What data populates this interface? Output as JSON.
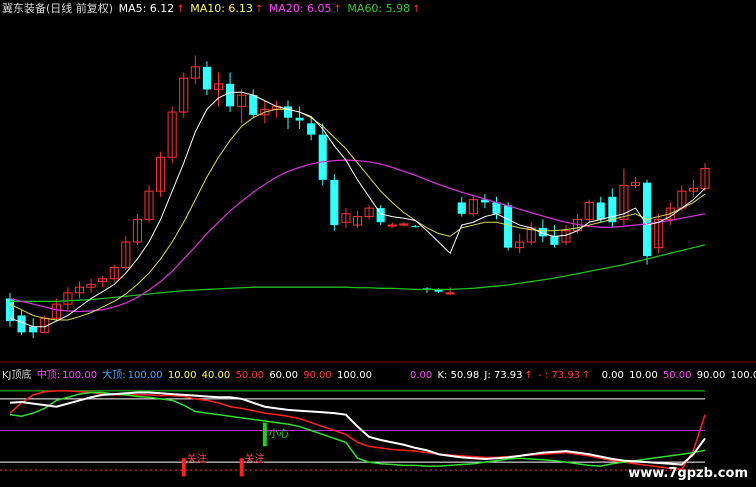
{
  "header": {
    "title": "冀东装备(日线 前复权)",
    "ma5_label": "MA5: 6.12",
    "ma10_label": "MA10: 6.13",
    "ma20_label": "MA20: 6.05",
    "ma60_label": "MA60: 5.98",
    "arrow": "↑",
    "colors": {
      "title": "#d8d8d8",
      "ma5": "#ffffff",
      "ma10": "#ffff66",
      "ma20": "#ff44ff",
      "ma60": "#33cc33",
      "arrow": "#ff3333"
    }
  },
  "indicator_header": {
    "name": "KJ顶底",
    "mid_label": "中顶:",
    "mid_value": "100.00",
    "big_label": "大顶:",
    "big_value": "100.00",
    "v1": "10.00",
    "v2": "40.00",
    "v3": "50.00",
    "v4": "60.00",
    "v5": "90.00",
    "v6": "100.00",
    "r0": "0.00",
    "k_label": "K: 50.98",
    "j_label": "J: 73.93",
    "dash_label": "- : 73.93",
    "r1": "0.00",
    "r2": "10.00",
    "r3": "50.00",
    "r4": "90.00",
    "r5": "100.00",
    "arrow": "↑"
  },
  "annotations": {
    "buy1": "关注",
    "buy2": "关注",
    "heart": "小心"
  },
  "watermark": "www.7gpzb.com",
  "chart_data": [
    {
      "type": "candlestick",
      "title": "冀东装备(日线 前复权)",
      "ohlc": [
        [
          5.6,
          5.7,
          5.1,
          5.2
        ],
        [
          5.3,
          5.4,
          4.95,
          5.0
        ],
        [
          5.1,
          5.25,
          4.9,
          5.0
        ],
        [
          5.0,
          5.3,
          4.98,
          5.25
        ],
        [
          5.25,
          5.6,
          5.2,
          5.5
        ],
        [
          5.5,
          5.8,
          5.4,
          5.7
        ],
        [
          5.7,
          5.9,
          5.6,
          5.8
        ],
        [
          5.8,
          5.95,
          5.7,
          5.85
        ],
        [
          5.9,
          6.0,
          5.8,
          5.95
        ],
        [
          5.95,
          6.2,
          5.9,
          6.15
        ],
        [
          6.15,
          6.7,
          6.1,
          6.6
        ],
        [
          6.6,
          7.1,
          6.55,
          7.0
        ],
        [
          7.0,
          7.6,
          6.95,
          7.5
        ],
        [
          7.5,
          8.2,
          7.4,
          8.1
        ],
        [
          8.1,
          9.0,
          8.0,
          8.9
        ],
        [
          8.9,
          9.6,
          8.8,
          9.5
        ],
        [
          9.5,
          9.9,
          9.4,
          9.7
        ],
        [
          9.7,
          9.8,
          9.2,
          9.3
        ],
        [
          9.3,
          9.6,
          9.0,
          9.4
        ],
        [
          9.4,
          9.6,
          8.9,
          9.0
        ],
        [
          9.0,
          9.3,
          8.7,
          9.2
        ],
        [
          9.2,
          9.3,
          8.8,
          8.85
        ],
        [
          8.85,
          9.1,
          8.7,
          8.95
        ],
        [
          8.95,
          9.1,
          8.8,
          9.0
        ],
        [
          9.0,
          9.1,
          8.6,
          8.8
        ],
        [
          8.8,
          9.0,
          8.6,
          8.75
        ],
        [
          8.7,
          8.8,
          8.4,
          8.5
        ],
        [
          8.5,
          8.7,
          7.6,
          7.7
        ],
        [
          7.7,
          7.8,
          6.8,
          6.9
        ],
        [
          6.95,
          7.2,
          6.85,
          7.1
        ],
        [
          6.9,
          7.15,
          6.85,
          7.05
        ],
        [
          7.05,
          7.25,
          7.0,
          7.2
        ],
        [
          7.2,
          7.25,
          6.9,
          6.95
        ],
        [
          6.9,
          6.95,
          6.85,
          6.9
        ],
        [
          6.9,
          6.95,
          6.88,
          6.92
        ],
        [
          6.88,
          6.9,
          6.86,
          6.87
        ],
        [
          5.78,
          5.8,
          5.7,
          5.76
        ],
        [
          5.75,
          5.78,
          5.7,
          5.72
        ],
        [
          5.7,
          5.8,
          5.66,
          5.7
        ],
        [
          7.3,
          7.4,
          7.05,
          7.1
        ],
        [
          7.1,
          7.4,
          7.05,
          7.35
        ],
        [
          7.35,
          7.45,
          7.2,
          7.3
        ],
        [
          7.3,
          7.4,
          7.0,
          7.1
        ],
        [
          7.25,
          7.3,
          6.45,
          6.5
        ],
        [
          6.5,
          6.75,
          6.4,
          6.6
        ],
        [
          6.6,
          6.95,
          6.55,
          6.85
        ],
        [
          6.85,
          7.0,
          6.6,
          6.7
        ],
        [
          6.7,
          6.9,
          6.5,
          6.55
        ],
        [
          6.6,
          6.9,
          6.55,
          6.8
        ],
        [
          6.8,
          7.1,
          6.75,
          7.0
        ],
        [
          7.0,
          7.35,
          6.95,
          7.3
        ],
        [
          7.3,
          7.4,
          6.95,
          7.0
        ],
        [
          7.4,
          7.55,
          6.85,
          6.95
        ],
        [
          7.0,
          7.9,
          6.9,
          7.6
        ],
        [
          7.6,
          7.75,
          7.55,
          7.65
        ],
        [
          7.65,
          7.7,
          6.2,
          6.35
        ],
        [
          6.5,
          7.1,
          6.4,
          7.0
        ],
        [
          7.0,
          7.3,
          6.9,
          7.2
        ],
        [
          7.2,
          7.6,
          7.15,
          7.5
        ],
        [
          7.5,
          7.7,
          7.4,
          7.55
        ],
        [
          7.55,
          8.0,
          7.5,
          7.9
        ]
      ],
      "ma5": [
        5.25,
        5.18,
        5.1,
        5.1,
        5.2,
        5.3,
        5.45,
        5.6,
        5.72,
        5.85,
        6.05,
        6.3,
        6.6,
        7.0,
        7.5,
        8.0,
        8.55,
        8.95,
        9.15,
        9.25,
        9.25,
        9.2,
        9.1,
        9.0,
        8.95,
        8.9,
        8.82,
        8.6,
        8.3,
        8.05,
        7.7,
        7.4,
        7.1,
        7.05,
        7.02,
        6.98,
        6.8,
        6.6,
        6.4,
        6.9,
        6.95,
        7.05,
        7.1,
        7.0,
        6.9,
        6.85,
        6.75,
        6.7,
        6.72,
        6.8,
        6.95,
        7.0,
        7.05,
        7.1,
        7.2,
        6.9,
        6.95,
        7.05,
        7.2,
        7.35,
        7.55
      ],
      "ma10": [
        5.5,
        5.4,
        5.3,
        5.25,
        5.22,
        5.22,
        5.28,
        5.35,
        5.45,
        5.55,
        5.68,
        5.85,
        6.05,
        6.3,
        6.6,
        6.95,
        7.35,
        7.75,
        8.1,
        8.4,
        8.65,
        8.8,
        8.9,
        8.95,
        8.95,
        8.9,
        8.8,
        8.65,
        8.45,
        8.25,
        8.0,
        7.75,
        7.5,
        7.3,
        7.12,
        6.98,
        6.85,
        6.75,
        6.7,
        6.85,
        6.9,
        6.95,
        6.95,
        6.9,
        6.85,
        6.82,
        6.8,
        6.8,
        6.82,
        6.85,
        6.9,
        6.95,
        7.0,
        7.05,
        7.1,
        7.0,
        7.05,
        7.1,
        7.2,
        7.3,
        7.45
      ],
      "ma20": [
        5.6,
        5.55,
        5.5,
        5.45,
        5.4,
        5.38,
        5.37,
        5.38,
        5.4,
        5.45,
        5.52,
        5.62,
        5.75,
        5.9,
        6.08,
        6.3,
        6.52,
        6.75,
        6.95,
        7.15,
        7.32,
        7.48,
        7.62,
        7.75,
        7.85,
        7.92,
        7.98,
        8.02,
        8.04,
        8.05,
        8.04,
        8.02,
        7.98,
        7.92,
        7.85,
        7.78,
        7.7,
        7.62,
        7.55,
        7.48,
        7.42,
        7.36,
        7.3,
        7.24,
        7.18,
        7.12,
        7.06,
        7.0,
        6.95,
        6.91,
        6.88,
        6.86,
        6.86,
        6.88,
        6.9,
        6.92,
        6.95,
        6.98,
        7.02,
        7.06,
        7.1
      ],
      "ma60": [
        5.55,
        5.55,
        5.55,
        5.55,
        5.55,
        5.56,
        5.57,
        5.58,
        5.6,
        5.62,
        5.64,
        5.66,
        5.68,
        5.7,
        5.72,
        5.74,
        5.75,
        5.76,
        5.77,
        5.78,
        5.79,
        5.8,
        5.8,
        5.8,
        5.8,
        5.8,
        5.8,
        5.8,
        5.8,
        5.8,
        5.79,
        5.79,
        5.78,
        5.78,
        5.77,
        5.76,
        5.76,
        5.76,
        5.76,
        5.77,
        5.78,
        5.8,
        5.82,
        5.84,
        5.87,
        5.9,
        5.93,
        5.96,
        6.0,
        6.04,
        6.08,
        6.12,
        6.16,
        6.2,
        6.25,
        6.3,
        6.35,
        6.4,
        6.45,
        6.5,
        6.55
      ],
      "ylim": [
        4.6,
        10.6
      ],
      "grid": false
    },
    {
      "type": "line",
      "title": "KJ顶底",
      "ylim": [
        -10,
        110
      ],
      "hlines": [
        100,
        90,
        50,
        10,
        0
      ],
      "white": [
        85,
        86,
        84,
        82,
        80,
        84,
        88,
        92,
        95,
        96,
        97,
        98,
        98,
        97,
        96,
        95,
        94,
        93,
        92,
        92,
        90,
        85,
        80,
        78,
        76,
        75,
        74,
        73,
        72,
        70,
        55,
        42,
        38,
        35,
        32,
        28,
        25,
        20,
        18,
        16,
        15,
        14,
        15,
        16,
        18,
        20,
        22,
        23,
        24,
        22,
        20,
        17,
        14,
        12,
        11,
        10,
        9,
        8,
        7,
        20,
        40
      ],
      "green": [
        70,
        68,
        72,
        78,
        88,
        92,
        96,
        98,
        98,
        96,
        95,
        93,
        92,
        90,
        88,
        82,
        74,
        72,
        70,
        68,
        66,
        64,
        62,
        60,
        58,
        55,
        50,
        45,
        40,
        35,
        15,
        10,
        8,
        7,
        6,
        6,
        5,
        5,
        6,
        7,
        8,
        10,
        12,
        14,
        15,
        14,
        13,
        12,
        10,
        8,
        6,
        5,
        8,
        10,
        12,
        14,
        16,
        18,
        20,
        22,
        25
      ],
      "red": [
        72,
        85,
        95,
        99,
        100,
        100,
        99,
        98,
        96,
        95,
        95,
        95,
        95,
        94,
        94,
        93,
        90,
        88,
        85,
        80,
        78,
        75,
        72,
        70,
        68,
        65,
        60,
        55,
        50,
        45,
        35,
        30,
        28,
        26,
        25,
        24,
        22,
        20,
        19,
        18,
        17,
        16,
        16,
        17,
        18,
        19,
        20,
        21,
        22,
        20,
        18,
        15,
        12,
        10,
        8,
        6,
        4,
        2,
        1,
        25,
        70
      ],
      "signals": [
        {
          "label": "关注",
          "index": 15
        },
        {
          "label": "关注",
          "index": 20
        },
        {
          "label": "小心",
          "index": 22
        }
      ]
    }
  ]
}
